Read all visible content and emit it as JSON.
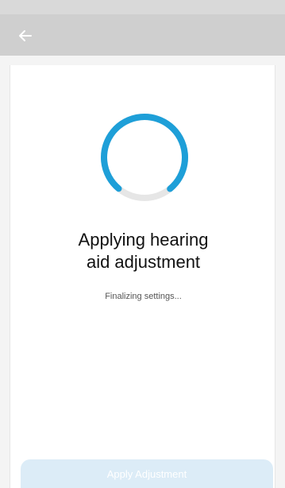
{
  "header": {
    "back_icon": "arrow-left-icon"
  },
  "progress": {
    "title_line1": "Applying hearing",
    "title_line2": "aid adjustment",
    "status": "Finalizing settings...",
    "fraction": 0.78,
    "accent_color": "#1e9fd8",
    "track_color": "#e6e6e6"
  },
  "footer": {
    "apply_label": "Apply Adjustment",
    "disabled_bg": "#dcecf7"
  }
}
